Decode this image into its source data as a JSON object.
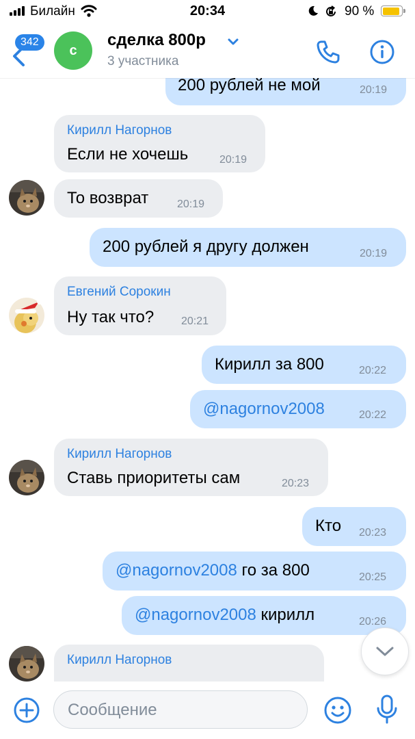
{
  "status_bar": {
    "carrier": "Билайн",
    "time": "20:34",
    "battery_percent": "90 %",
    "battery_level": 0.9
  },
  "header": {
    "back_badge": "342",
    "avatar_letter": "с",
    "title": "сделка 800р",
    "subtitle": "3 участника"
  },
  "messages": [
    {
      "direction": "out",
      "text": "200 рублей не мой",
      "time": "20:19"
    },
    {
      "direction": "in",
      "sender": "Кирилл Нагорнов",
      "text": "Если не хочешь",
      "time": "20:19"
    },
    {
      "direction": "in",
      "text": "То возврат",
      "time": "20:19"
    },
    {
      "direction": "out",
      "text": "200 рублей я другу должен",
      "time": "20:19"
    },
    {
      "direction": "in",
      "sender": "Евгений Сорокин",
      "text": "Ну так что?",
      "time": "20:21"
    },
    {
      "direction": "out",
      "text": "Кирилл за 800",
      "time": "20:22"
    },
    {
      "direction": "out",
      "mention": "@nagornov2008",
      "text": "",
      "time": "20:22"
    },
    {
      "direction": "in",
      "sender": "Кирилл Нагорнов",
      "text": "Ставь приоритеты сам",
      "time": "20:23"
    },
    {
      "direction": "out",
      "text": "Кто",
      "time": "20:23"
    },
    {
      "direction": "out",
      "mention": "@nagornov2008",
      "text": " го за 800",
      "time": "20:25"
    },
    {
      "direction": "out",
      "mention": "@nagornov2008",
      "text": " кирилл",
      "time": "20:26"
    },
    {
      "direction": "in",
      "sender": "Кирилл Нагорнов",
      "text": "",
      "time": ""
    }
  ],
  "composer": {
    "placeholder": "Сообщение"
  },
  "icons": {
    "back": "chevron-left-icon",
    "chevron": "chevron-down-icon",
    "phone": "phone-icon",
    "info": "info-icon",
    "plus": "plus-circle-icon",
    "emoji": "smile-icon",
    "mic": "microphone-icon",
    "scroll": "arrow-down-icon"
  },
  "colors": {
    "accent": "#2d81e0",
    "incoming_bubble": "#ebedf0",
    "outgoing_bubble": "#cce4ff",
    "secondary_text": "#818c99",
    "avatar_green": "#4bc25a"
  }
}
